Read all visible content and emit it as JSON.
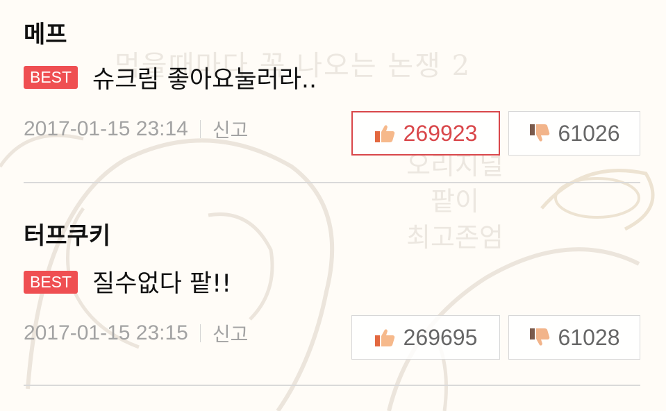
{
  "watermark": {
    "line1": "먹을때마다 꼭 나오는 논쟁 2",
    "line2": "오리지널",
    "line3": "팥이",
    "line4": "최고존엄"
  },
  "comments": [
    {
      "author": "메프",
      "badge": "BEST",
      "text": "슈크림 좋아요눌러라..",
      "date": "2017-01-15 23:14",
      "report": "신고",
      "likes": "269923",
      "dislikes": "61026",
      "liked": true
    },
    {
      "author": "터프쿠키",
      "badge": "BEST",
      "text": "질수없다 팥!!",
      "date": "2017-01-15 23:15",
      "report": "신고",
      "likes": "269695",
      "dislikes": "61028",
      "liked": false
    }
  ],
  "colors": {
    "best_badge": "#ef4f52",
    "active_like": "#d9474a",
    "meta_text": "#a3a3a3"
  },
  "icons": {
    "like": "thumbs-up-icon",
    "dislike": "thumbs-down-icon"
  }
}
